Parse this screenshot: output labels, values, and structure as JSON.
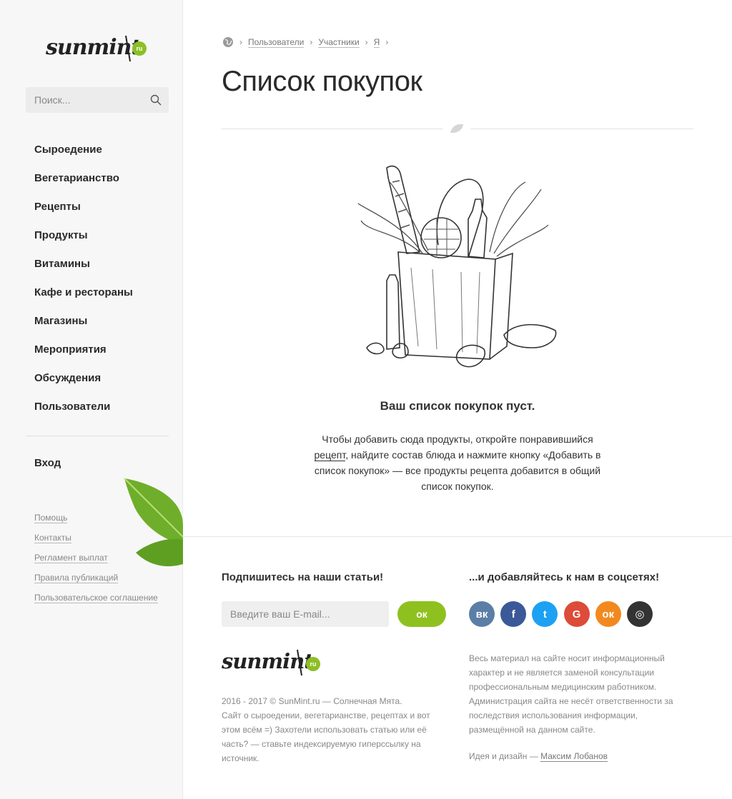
{
  "brand": {
    "logo_text": "sunmint",
    "logo_badge": "ru"
  },
  "sidebar": {
    "search_placeholder": "Поиск...",
    "nav": [
      "Сыроедение",
      "Вегетарианство",
      "Рецепты",
      "Продукты",
      "Витамины",
      "Кафе и рестораны",
      "Магазины",
      "Мероприятия",
      "Обсуждения",
      "Пользователи"
    ],
    "login": "Вход",
    "footer_links": [
      "Помощь",
      "Контакты",
      "Регламент выплат",
      "Правила публикаций",
      "Пользовательское соглашение"
    ]
  },
  "breadcrumb": [
    "Пользователи",
    "Участники",
    "Я"
  ],
  "page": {
    "title": "Список покупок",
    "empty_title": "Ваш список покупок пуст.",
    "empty_desc_before": "Чтобы добавить сюда продукты, откройте понравившийся ",
    "empty_desc_link": "рецепт",
    "empty_desc_after": ", найдите состав блюда и нажмите кнопку «Добавить в список покупок» — все продукты рецепта добавится в общий список покупок."
  },
  "footer": {
    "subscribe_title": "Подпишитесь на наши статьи!",
    "email_placeholder": "Введите ваш E-mail...",
    "ok_label": "ок",
    "copyright": "2016 - 2017 © SunMint.ru — Солнечная Мята.",
    "about": "Сайт о сыроедении, вегетарианстве, рецептах и вот этом всём =) Захотели использовать статью или её часть? — ставьте индексируемую гиперссылку на источник.",
    "social_title": "...и добавляйтесь к нам в соцсетях!",
    "socials": [
      {
        "name": "vk",
        "label": "вк",
        "color": "#5b7ea6"
      },
      {
        "name": "facebook",
        "label": "f",
        "color": "#3b5998"
      },
      {
        "name": "twitter",
        "label": "t",
        "color": "#1da1f2"
      },
      {
        "name": "google",
        "label": "G",
        "color": "#dd4b39"
      },
      {
        "name": "odnoklassniki",
        "label": "ок",
        "color": "#f2891f"
      },
      {
        "name": "instagram",
        "label": "◎",
        "color": "#333333"
      }
    ],
    "disclaimer": "Весь материал на сайте носит информационный характер и не является заменой консультации профессиональным медицинским работником. Администрация сайта не несёт ответственности за последствия использования информации, размещённой на данном сайте.",
    "credit_prefix": "Идея и дизайн — ",
    "credit_name": "Максим Лобанов"
  }
}
